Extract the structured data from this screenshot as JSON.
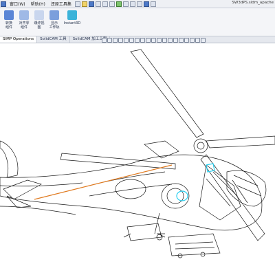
{
  "app": {
    "doc_title": "SW3dPS.sldm_apache"
  },
  "menu": [
    {
      "label": "窗口(W)"
    },
    {
      "label": "帮助(H)"
    },
    {
      "label": "还原工具集"
    }
  ],
  "ribbon": {
    "buttons": [
      {
        "label": "转换\n组件"
      },
      {
        "label": "对齐零\n组件"
      },
      {
        "label": "爆炸视\n图"
      },
      {
        "label": "显示\n工作轨"
      },
      {
        "label": "Instant3D"
      }
    ]
  },
  "tabs": [
    {
      "label": "SIMP Operations"
    },
    {
      "label": "SolidCAM 工具"
    },
    {
      "label": "SolidCAM 加工工程"
    }
  ],
  "colors": {
    "accent_blue": "#4d79c7",
    "highlight_cyan": "#29d0f0",
    "highlight_orange": "#e07a1f",
    "wire": "#1a1a1a"
  },
  "model": {
    "name": "helicopter-wireframe"
  }
}
